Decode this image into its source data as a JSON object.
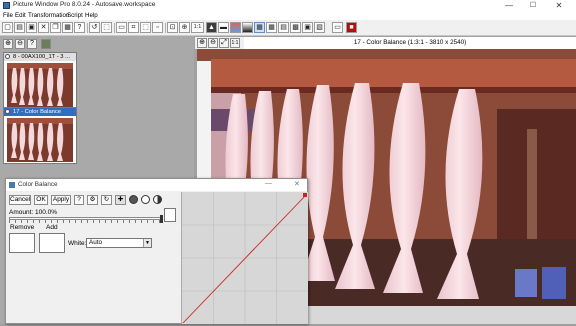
{
  "window": {
    "title": "Picture Window Pro 8.0.24  -  Autosave.workspace",
    "minimize": "—",
    "maximize": "☐",
    "close": "✕"
  },
  "menu": [
    "File",
    "Edit",
    "Transformation",
    "Script",
    "Help"
  ],
  "toolbar": {
    "zoom_label": "1:1",
    "zoom_label_small": "1:1"
  },
  "thumbnails": [
    {
      "label": "8 - 00AX100_1T - 3 ..."
    },
    {
      "label": "17 - Color Balance"
    }
  ],
  "image_window": {
    "title": "17 - Color Balance (1:3:1 - 3810 x 2540)"
  },
  "dialog": {
    "title": "Color Balance",
    "cancel": "Cancel",
    "ok": "OK",
    "apply": "Apply",
    "help": "?",
    "amount_label": "Amount: 100.0%",
    "amount_value": 1.0,
    "remove_label": "Remove",
    "add_label": "Add",
    "white_label": "White:",
    "white_value": "Auto"
  },
  "colors": {
    "accent": "#2f6fc0",
    "curve": "#d02020",
    "photo_background": "#7a3226"
  }
}
